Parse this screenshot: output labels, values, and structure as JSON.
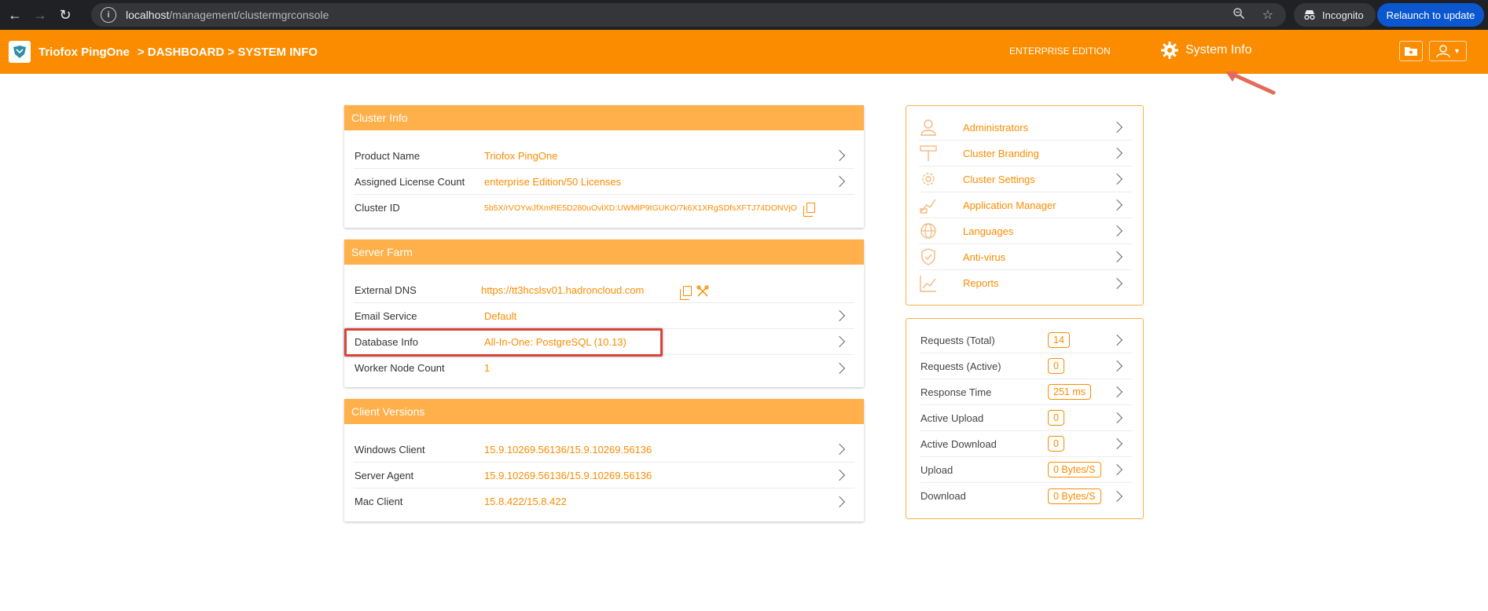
{
  "browser": {
    "url_host": "localhost",
    "url_path": "/management/clustermgrconsole",
    "incognito_label": "Incognito",
    "relaunch_label": "Relaunch to update"
  },
  "header": {
    "brand": "Triofox PingOne",
    "breadcrumb": ">  DASHBOARD > SYSTEM INFO",
    "edition": "ENTERPRISE EDITION",
    "system_info_label": "System Info"
  },
  "cluster_info": {
    "title": "Cluster Info",
    "rows": [
      {
        "label": "Product Name",
        "value": "Triofox PingOne"
      },
      {
        "label": "Assigned License Count",
        "value": "enterprise Edition/50 Licenses"
      },
      {
        "label": "Cluster ID",
        "value": "5b5X/rVOYwJfXmRE5D280uOvlXD:UWMlP9tGUKO/7k6X1XRgSDfsXFTJ74DONVjO"
      }
    ]
  },
  "server_farm": {
    "title": "Server Farm",
    "rows": [
      {
        "label": "External DNS",
        "value": "https://tt3hcslsv01.hadroncloud.com"
      },
      {
        "label": "Email Service",
        "value": "Default"
      },
      {
        "label": "Database Info",
        "value": "All-In-One: PostgreSQL (10.13)"
      },
      {
        "label": "Worker Node Count",
        "value": "1"
      }
    ]
  },
  "client_versions": {
    "title": "Client Versions",
    "rows": [
      {
        "label": "Windows Client",
        "value": "15.9.10269.56136/15.9.10269.56136"
      },
      {
        "label": "Server Agent",
        "value": "15.9.10269.56136/15.9.10269.56136"
      },
      {
        "label": "Mac Client",
        "value": "15.8.422/15.8.422"
      }
    ]
  },
  "side_menu": [
    {
      "label": "Administrators",
      "icon": "user-icon"
    },
    {
      "label": "Cluster Branding",
      "icon": "paint-roller-icon"
    },
    {
      "label": "Cluster Settings",
      "icon": "gear-icon"
    },
    {
      "label": "Application Manager",
      "icon": "app-manager-icon"
    },
    {
      "label": "Languages",
      "icon": "globe-icon"
    },
    {
      "label": "Anti-virus",
      "icon": "shield-icon"
    },
    {
      "label": "Reports",
      "icon": "chart-icon"
    }
  ],
  "stats": [
    {
      "label": "Requests (Total)",
      "value": "14"
    },
    {
      "label": "Requests (Active)",
      "value": "0"
    },
    {
      "label": "Response Time",
      "value": "251 ms"
    },
    {
      "label": "Active Upload",
      "value": "0"
    },
    {
      "label": "Active Download",
      "value": "0"
    },
    {
      "label": "Upload",
      "value": "0 Bytes/S"
    },
    {
      "label": "Download",
      "value": "0 Bytes/S"
    }
  ],
  "colors": {
    "accent": "#fb8c00",
    "panel_header": "#ffb04a",
    "highlight": "#d9443a"
  }
}
